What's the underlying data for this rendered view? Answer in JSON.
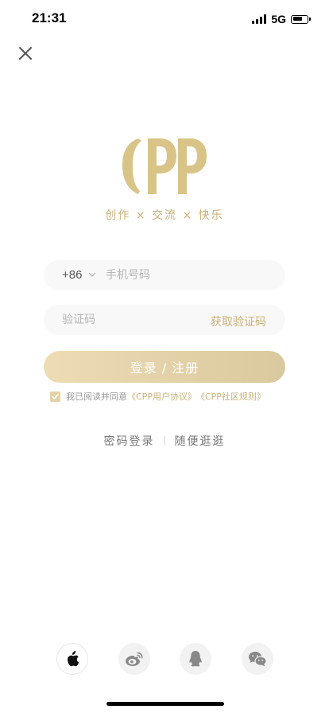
{
  "status_bar": {
    "time": "21:31",
    "network": "5G"
  },
  "brand": {
    "logo_text": "CPP",
    "slogan": "创作 × 交流 × 快乐",
    "accent_color": "#cbb27a"
  },
  "form": {
    "country_code": "+86",
    "phone_placeholder": "手机号码",
    "code_placeholder": "验证码",
    "get_code_label": "获取验证码",
    "submit_label": "登录 / 注册"
  },
  "agreement": {
    "checked": true,
    "prefix": "我已阅读并同意",
    "user_agreement": "《CPP用户协议》",
    "community_rules": "《CPP社区规则》"
  },
  "alt_actions": {
    "password_login": "密码登录",
    "browse": "随便逛逛"
  },
  "social_logins": [
    {
      "icon": "apple-icon"
    },
    {
      "icon": "weibo-icon"
    },
    {
      "icon": "qq-icon"
    },
    {
      "icon": "wechat-icon"
    }
  ]
}
